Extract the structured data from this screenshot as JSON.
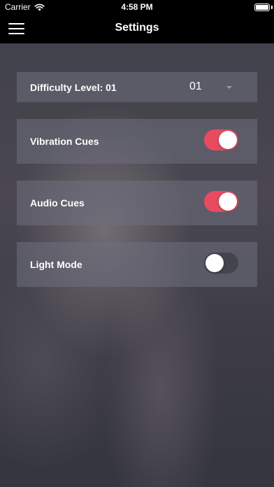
{
  "status_bar": {
    "carrier": "Carrier",
    "time": "4:58 PM"
  },
  "nav": {
    "title": "Settings",
    "menu_icon": "hamburger-menu-icon"
  },
  "settings": {
    "difficulty": {
      "label": "Difficulty Level: 01",
      "value": "01"
    },
    "vibration": {
      "label": "Vibration Cues",
      "on": true
    },
    "audio": {
      "label": "Audio Cues",
      "on": true
    },
    "light_mode": {
      "label": "Light Mode",
      "on": false
    }
  },
  "colors": {
    "toggle_on": "#e84a5f",
    "bar": "#000000",
    "text": "#ffffff"
  }
}
